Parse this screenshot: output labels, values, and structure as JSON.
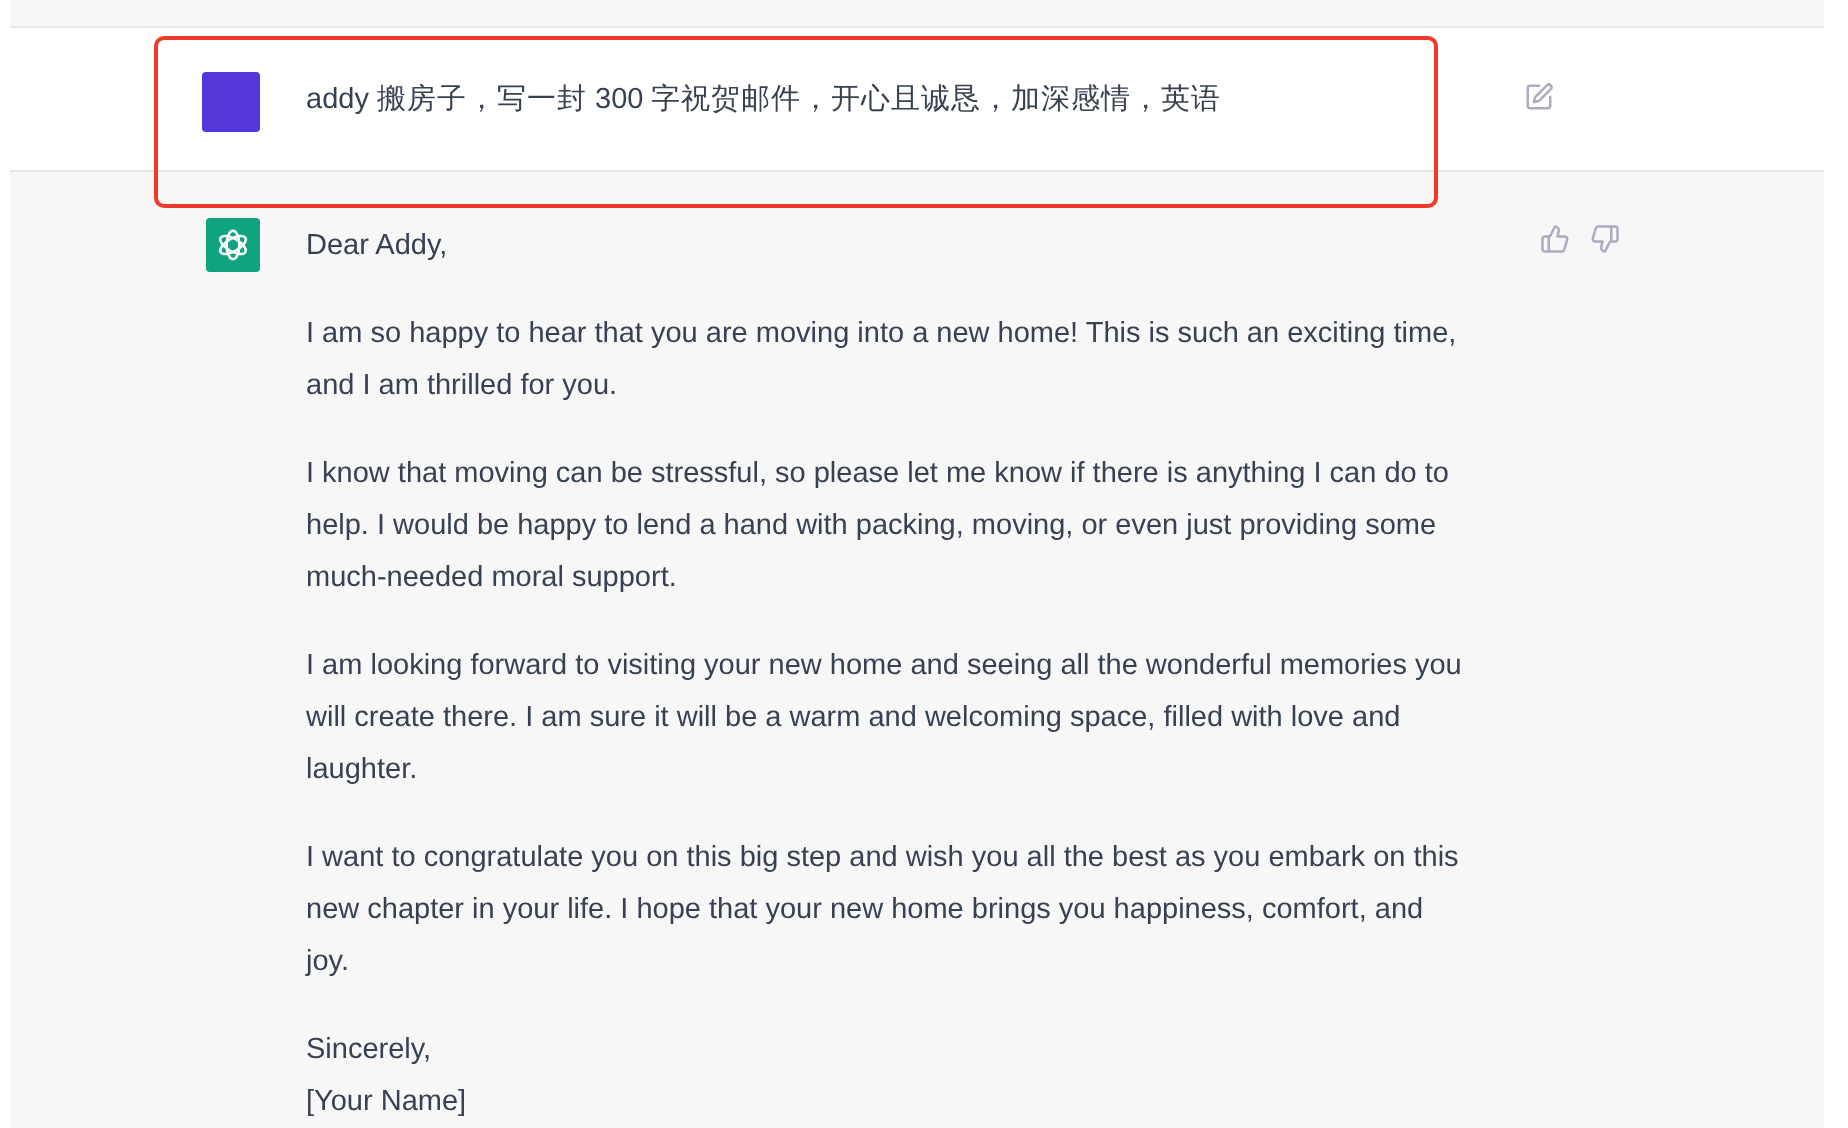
{
  "user_message": {
    "text": "addy 搬房子，写一封 300 字祝贺邮件，开心且诚恳，加深感情，英语",
    "highlighted": true
  },
  "assistant_message": {
    "greeting": "Dear Addy,",
    "paragraphs": [
      "I am so happy to hear that you are moving into a new home! This is such an exciting time, and I am thrilled for you.",
      "I know that moving can be stressful, so please let me know if there is anything I can do to help. I would be happy to lend a hand with packing, moving, or even just providing some much-needed moral support.",
      "I am looking forward to visiting your new home and seeing all the wonderful memories you will create there. I am sure it will be a warm and welcoming space, filled with love and laughter.",
      "I want to congratulate you on this big step and wish you all the best as you embark on this new chapter in your life. I hope that your new home brings you happiness, comfort, and joy."
    ],
    "closing": [
      "Sincerely,",
      "[Your Name]"
    ]
  }
}
